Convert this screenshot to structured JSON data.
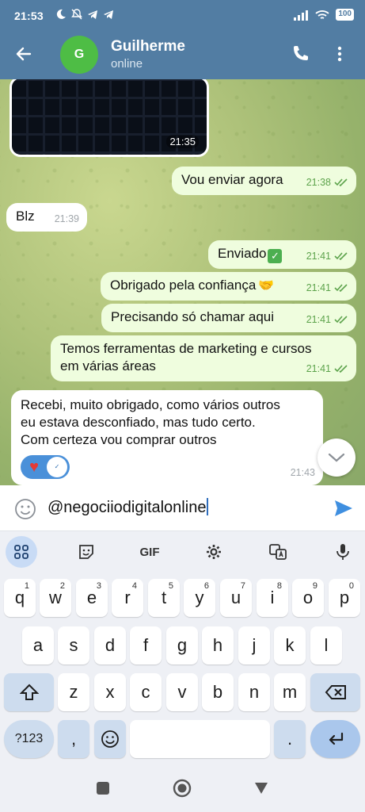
{
  "status_bar": {
    "time": "21:53",
    "battery": "100"
  },
  "header": {
    "avatar_letter": "G",
    "name": "Guilherme",
    "status": "online"
  },
  "messages": [
    {
      "id": "media",
      "time": "21:35"
    },
    {
      "id": "m1",
      "text": "Vou enviar agora",
      "time": "21:38"
    },
    {
      "id": "m2",
      "text": "Blz",
      "time": "21:39"
    },
    {
      "id": "m3",
      "text": "Enviado",
      "time": "21:41"
    },
    {
      "id": "m4",
      "text": "Obrigado pela confiança",
      "time": "21:41"
    },
    {
      "id": "m5",
      "text": "Precisando só chamar aqui",
      "time": "21:41"
    },
    {
      "id": "m6",
      "line1": "Temos ferramentas de marketing e cursos",
      "line2": "em várias áreas",
      "time": "21:41"
    },
    {
      "id": "m7",
      "line1": "Recebi, muito obrigado, como vários outros",
      "line2": "eu estava desconfiado, mas tudo certo.",
      "line3": "Com certeza vou comprar outros",
      "time": "21:43"
    }
  ],
  "input": {
    "value": "@negociiodigitalonline"
  },
  "keyboard": {
    "tools": {
      "gif": "GIF"
    },
    "row1": [
      "q",
      "w",
      "e",
      "r",
      "t",
      "y",
      "u",
      "i",
      "o",
      "p"
    ],
    "row1_sup": [
      "1",
      "2",
      "3",
      "4",
      "5",
      "6",
      "7",
      "8",
      "9",
      "0"
    ],
    "row2": [
      "a",
      "s",
      "d",
      "f",
      "g",
      "h",
      "j",
      "k",
      "l"
    ],
    "row3": [
      "z",
      "x",
      "c",
      "v",
      "b",
      "n",
      "m"
    ],
    "symbols": "?123",
    "comma": ",",
    "period": "."
  },
  "colors": {
    "header": "#527da3",
    "outgoing": "#effdde",
    "incoming": "#ffffff",
    "check": "#5da34c",
    "send": "#3f8fe0"
  }
}
